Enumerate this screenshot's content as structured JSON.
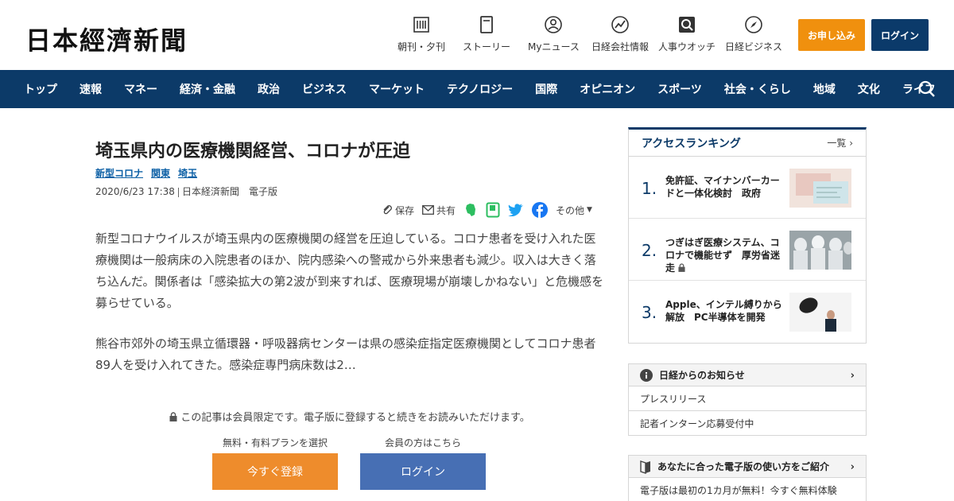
{
  "header": {
    "logo": "日本經濟新聞",
    "nav": [
      {
        "label": "朝刊・夕刊",
        "icon": "newspaper-icon"
      },
      {
        "label": "ストーリー",
        "icon": "story-icon"
      },
      {
        "label": "Myニュース",
        "icon": "person-icon"
      },
      {
        "label": "日経会社情報",
        "icon": "chart-icon"
      },
      {
        "label": "人事ウオッチ",
        "icon": "search-person-icon"
      },
      {
        "label": "日経ビジネス",
        "icon": "compass-icon"
      }
    ],
    "apply_label": "お申し込み",
    "login_label": "ログイン"
  },
  "navbar": {
    "items": [
      "トップ",
      "速報",
      "マネー",
      "経済・金融",
      "政治",
      "ビジネス",
      "マーケット",
      "テクノロジー",
      "国際",
      "オピニオン",
      "スポーツ",
      "社会・くらし",
      "地域",
      "文化",
      "ライフ"
    ]
  },
  "article": {
    "title": "埼玉県内の医療機関経営、コロナが圧迫",
    "tags": [
      "新型コロナ",
      "関東",
      "埼玉"
    ],
    "date": "2020/6/23 17:38",
    "source": "日本経済新聞　電子版",
    "share": {
      "save": "保存",
      "share": "共有",
      "more": "その他"
    },
    "paragraph1": "新型コロナウイルスが埼玉県内の医療機関の経営を圧迫している。コロナ患者を受け入れた医療機関は一般病床の入院患者のほか、院内感染への警戒から外来患者も減少。収入は大きく落ち込んだ。関係者は「感染拡大の第2波が到来すれば、医療現場が崩壊しかねない」と危機感を募らせている。",
    "paragraph2": "熊谷市郊外の埼玉県立循環器・呼吸器病センターは県の感染症指定医療機関としてコロナ患者89人を受け入れてきた。感染症専門病床数は2…",
    "member_note": "この記事は会員限定です。電子版に登録すると続きをお読みいただけます。",
    "register_caption": "無料・有料プランを選択",
    "login_caption": "会員の方はこちら",
    "register_label": "今すぐ登録",
    "login_label": "ログイン"
  },
  "ranking": {
    "title": "アクセスランキング",
    "more": "一覧",
    "items": [
      {
        "num": "1.",
        "text": "免許証、マイナンバーカードと一体化検討　政府"
      },
      {
        "num": "2.",
        "text": "つぎはぎ医療システム、コロナで機能せず　厚労省迷走"
      },
      {
        "num": "3.",
        "text": "Apple、インテル縛りから解放　PC半導体を開発"
      }
    ]
  },
  "info1": {
    "title": "日経からのお知らせ",
    "rows": [
      "プレスリリース",
      "記者インターン応募受付中"
    ]
  },
  "info2": {
    "title": "あなたに合った電子版の使い方をご紹介",
    "rows": [
      "電子版は最初の1カ月が無料！今すぐ無料体験"
    ]
  },
  "colors": {
    "navy": "#0c3a68",
    "orange": "#f0900e",
    "register": "#ee8c2c",
    "login_blue": "#476fb4",
    "link": "#0b5fa5"
  }
}
